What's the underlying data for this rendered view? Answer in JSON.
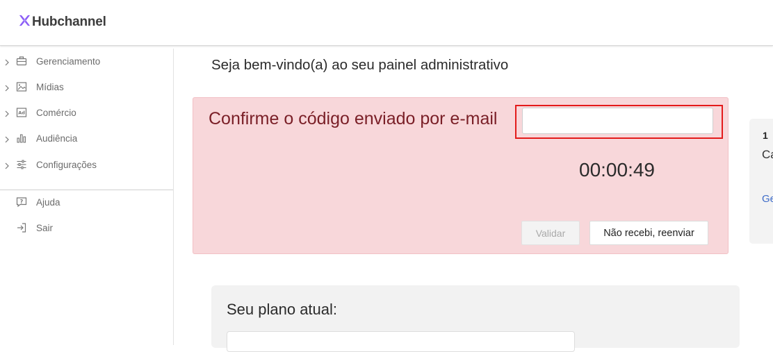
{
  "header": {
    "logo_text": "Hubchannel",
    "logo_icon": "hubchannel-x-icon",
    "brand_color": "#8b5cf6"
  },
  "sidebar": {
    "items": [
      {
        "label": "Gerenciamento",
        "icon": "briefcase-icon",
        "expandable": true
      },
      {
        "label": "Mídias",
        "icon": "image-icon",
        "expandable": true
      },
      {
        "label": "Comércio",
        "icon": "ad-icon",
        "expandable": true
      },
      {
        "label": "Audiência",
        "icon": "bar-chart-icon",
        "expandable": true
      },
      {
        "label": "Configurações",
        "icon": "sliders-icon",
        "expandable": true
      },
      {
        "label": "Ajuda",
        "icon": "help-icon",
        "expandable": false
      },
      {
        "label": "Sair",
        "icon": "logout-icon",
        "expandable": false
      }
    ]
  },
  "main": {
    "welcome": "Seja bem-vindo(a) ao seu painel administrativo",
    "verification": {
      "title": "Confirme o código enviado por e-mail",
      "code_value": "",
      "code_placeholder": "",
      "timer": "00:00:49",
      "validate_label": "Validar",
      "resend_label": "Não recebi, reenviar",
      "bg_color": "#f8d7da",
      "highlight_color": "#e31b1b"
    },
    "plan": {
      "title": "Seu plano atual:"
    }
  },
  "side_card": {
    "number": "1",
    "text": "Ca",
    "link": "Ge"
  }
}
